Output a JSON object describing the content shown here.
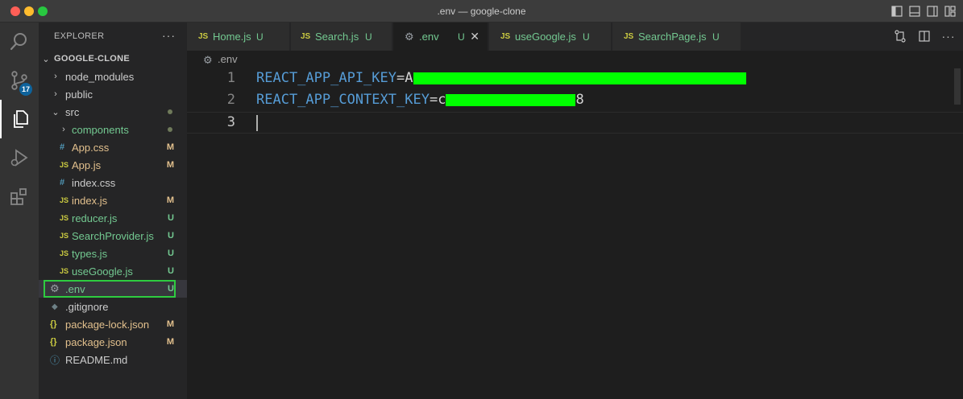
{
  "window": {
    "title": ".env — google-clone"
  },
  "activity_bar": {
    "items": [
      {
        "name": "search-icon"
      },
      {
        "name": "source-control-icon",
        "badge": "17"
      },
      {
        "name": "explorer-icon"
      },
      {
        "name": "run-debug-icon"
      },
      {
        "name": "extensions-icon"
      }
    ]
  },
  "sidebar": {
    "header": "EXPLORER",
    "more": "···",
    "root": "GOOGLE-CLONE",
    "tree": [
      {
        "label": "node_modules",
        "type": "folder",
        "status": ""
      },
      {
        "label": "public",
        "type": "folder",
        "status": ""
      },
      {
        "label": "src",
        "type": "folder-open",
        "status": "•"
      },
      {
        "label": "components",
        "type": "folder",
        "status": "•"
      },
      {
        "label": "App.css",
        "type": "css",
        "icon": "#",
        "status": "M"
      },
      {
        "label": "App.js",
        "type": "js",
        "icon": "JS",
        "status": "M"
      },
      {
        "label": "index.css",
        "type": "css",
        "icon": "#",
        "status": ""
      },
      {
        "label": "index.js",
        "type": "js",
        "icon": "JS",
        "status": "M"
      },
      {
        "label": "reducer.js",
        "type": "js",
        "icon": "JS",
        "status": "U"
      },
      {
        "label": "SearchProvider.js",
        "type": "js",
        "icon": "JS",
        "status": "U"
      },
      {
        "label": "types.js",
        "type": "js",
        "icon": "JS",
        "status": "U"
      },
      {
        "label": "useGoogle.js",
        "type": "js",
        "icon": "JS",
        "status": "U"
      },
      {
        "label": ".env",
        "type": "env",
        "icon": "⚙",
        "status": "U"
      },
      {
        "label": ".gitignore",
        "type": "git",
        "icon": "◆",
        "status": ""
      },
      {
        "label": "package-lock.json",
        "type": "json",
        "icon": "{}",
        "status": "M"
      },
      {
        "label": "package.json",
        "type": "json",
        "icon": "{}",
        "status": "M"
      },
      {
        "label": "README.md",
        "type": "md",
        "icon": "ⓘ",
        "status": ""
      }
    ]
  },
  "tabs": [
    {
      "icon": "JS",
      "label": "Home.js",
      "status": "U"
    },
    {
      "icon": "JS",
      "label": "Search.js",
      "status": "U"
    },
    {
      "icon": "⚙",
      "label": ".env",
      "status": "U",
      "close": "✕",
      "active": true
    },
    {
      "icon": "JS",
      "label": "useGoogle.js",
      "status": "U"
    },
    {
      "icon": "JS",
      "label": "SearchPage.js",
      "status": "U"
    }
  ],
  "breadcrumb": {
    "file": ".env"
  },
  "editor": {
    "lines": [
      {
        "number": "1",
        "key": "REACT_APP_API_KEY",
        "eq": "=",
        "prefix": "A",
        "suffix": ""
      },
      {
        "number": "2",
        "key": "REACT_APP_CONTEXT_KEY",
        "eq": "=",
        "prefix": "c",
        "suffix": "8"
      },
      {
        "number": "3",
        "key": "",
        "eq": "",
        "prefix": "",
        "suffix": ""
      }
    ]
  },
  "colors": {
    "redaction": "#00ff00",
    "selection_outline": "#2ecc40",
    "untracked": "#73c991",
    "modified": "#e2c08d",
    "key": "#569cd6"
  }
}
